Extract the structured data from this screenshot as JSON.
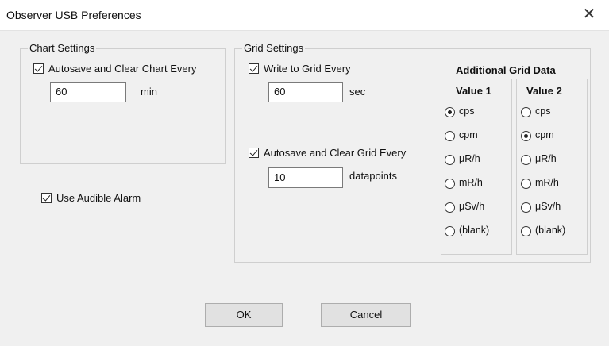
{
  "window": {
    "title": "Observer USB Preferences",
    "close_glyph": "✕"
  },
  "chart_settings": {
    "group_title": "Chart Settings",
    "autosave_label": "Autosave and Clear Chart Every",
    "autosave_checked": true,
    "interval_value": "60",
    "interval_unit": "min"
  },
  "alarm": {
    "label": "Use Audible Alarm",
    "checked": true
  },
  "grid_settings": {
    "group_title": "Grid Settings",
    "write_label": "Write to Grid Every",
    "write_checked": true,
    "write_value": "60",
    "write_unit": "sec",
    "autosave_label": "Autosave and Clear Grid Every",
    "autosave_checked": true,
    "autosave_value": "10",
    "autosave_unit": "datapoints",
    "additional": {
      "title": "Additional Grid Data",
      "value1": {
        "header": "Value 1",
        "options": [
          "cps",
          "cpm",
          "μR/h",
          "mR/h",
          "μSv/h",
          "(blank)"
        ],
        "selected": "cps"
      },
      "value2": {
        "header": "Value 2",
        "options": [
          "cps",
          "cpm",
          "μR/h",
          "mR/h",
          "μSv/h",
          "(blank)"
        ],
        "selected": "cpm"
      }
    }
  },
  "buttons": {
    "ok": "OK",
    "cancel": "Cancel"
  }
}
